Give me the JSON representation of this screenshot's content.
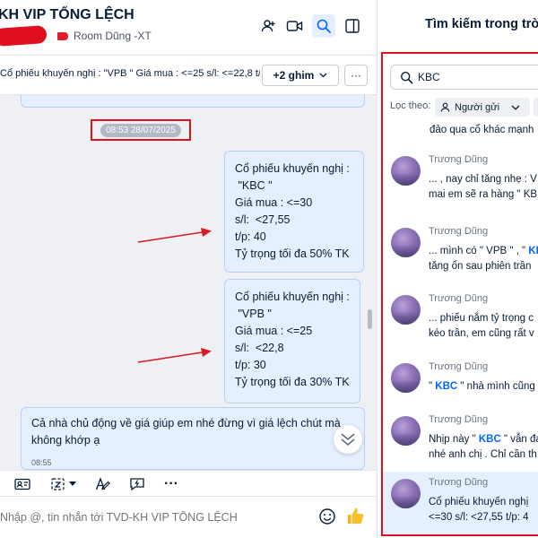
{
  "header": {
    "title": "KH VIP TỔNG LỆCH",
    "subtitle": "Room Dũng -XT"
  },
  "pin": {
    "text": "Cổ phiếu khuyến nghị : \"VPB \"  Giá mua : <=25 s/l:  <=22,8  t/p: 30",
    "button_label": "+2 ghim",
    "more_label": "···"
  },
  "timestamp": "08:53 28/07/2025",
  "messages": [
    {
      "lines": [
        "Cổ phiếu khuyến nghị :",
        " \"KBC \"",
        "Giá mua : <=30",
        "s/l:  <27,55",
        "t/p: 40",
        "Tỷ trọng tối đa 50% TK"
      ]
    },
    {
      "lines": [
        "Cổ phiếu khuyến nghị :",
        " \"VPB \"",
        "Giá mua : <=25",
        "s/l:  <22,8",
        "t/p: 30",
        "Tỷ trọng tối đa 30% TK"
      ]
    },
    {
      "lines": [
        "Cả nhà chủ động về giá giúp em nhé đừng vì giá lệch chút mà",
        "không khớp ạ"
      ],
      "time": "08:55"
    }
  ],
  "composer": {
    "placeholder": "Nhập @, tin nhắn tới TVD-KH VIP TỔNG LỆCH"
  },
  "search": {
    "title": "Tìm kiếm trong trò chuyện",
    "query": "KBC",
    "filter_label": "Lọc theo:",
    "filter_sender": "Người gửi",
    "top_snippet": "đảo qua cổ khác mạnh",
    "results": [
      {
        "name": "Trương Dũng",
        "line1_pre": "... , nay chỉ tăng nhẹ : V",
        "line1_hl": "",
        "line1_post": "",
        "line2_pre": "mai em sẽ ra hàng \" KB",
        "line2_hl": "",
        "line2_post": ""
      },
      {
        "name": "Trương Dũng",
        "line1_pre": "... mình có \" VPB \" , \" ",
        "line1_hl": "KB",
        "line1_post": "",
        "line2_pre": "tăng ổn sau phiên trần",
        "line2_hl": "",
        "line2_post": ""
      },
      {
        "name": "Trương Dũng",
        "line1_pre": "... phiếu nắm tỷ trọng c",
        "line1_hl": "",
        "line1_post": "",
        "line2_pre": "kéo trần, em cũng rất v",
        "line2_hl": "",
        "line2_post": ""
      },
      {
        "name": "Trương Dũng",
        "line1_pre": "\" ",
        "line1_hl": "KBC",
        "line1_post": " \" nhà mình cũng",
        "line2_pre": "",
        "line2_hl": "",
        "line2_post": ""
      },
      {
        "name": "Trương Dũng",
        "line1_pre": "Nhịp này \" ",
        "line1_hl": "KBC",
        "line1_post": " \" vẫn đa",
        "line2_pre": "nhé anh chị . Chỉ cần th",
        "line2_hl": "",
        "line2_post": ""
      },
      {
        "name": "Trương Dũng",
        "line1_pre": "Cổ phiếu khuyến nghị",
        "line1_hl": "",
        "line1_post": "",
        "line2_pre": "<=30 s/l: <27,55 t/p: 4",
        "line2_hl": "",
        "line2_post": ""
      }
    ]
  },
  "colors": {
    "accent": "#0068ff",
    "bubble_bg": "#e5efff",
    "highlight_red": "#e0101e",
    "chat_bg": "#eef0f3"
  },
  "icons": {
    "header": [
      "add-member-icon",
      "video-call-icon",
      "search-icon",
      "sidebar-toggle-icon"
    ],
    "toolbar": [
      "contact-card-icon",
      "screenshot-icon",
      "format-text-icon",
      "quick-message-icon",
      "more-icon"
    ],
    "composer": [
      "emoji-icon",
      "thumbs-up-icon"
    ]
  }
}
